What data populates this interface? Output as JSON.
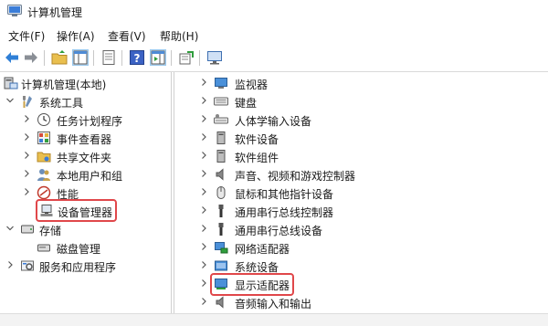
{
  "window": {
    "title": "计算机管理"
  },
  "menu": [
    "文件(F)",
    "操作(A)",
    "查看(V)",
    "帮助(H)"
  ],
  "toolbar": {
    "icons": [
      "back-arrow-icon",
      "forward-arrow-icon",
      "up-folder-icon",
      "show-console-tree-icon",
      "properties-icon",
      "help-icon",
      "action-pane-icon",
      "export-list-icon",
      "monitor-icon"
    ]
  },
  "tree": {
    "root": "计算机管理(本地)",
    "system_tools": "系统工具",
    "task_scheduler": "任务计划程序",
    "event_viewer": "事件查看器",
    "shared_folders": "共享文件夹",
    "local_users": "本地用户和组",
    "performance": "性能",
    "device_manager": "设备管理器",
    "storage": "存储",
    "disk_management": "磁盘管理",
    "services_apps": "服务和应用程序"
  },
  "devices": [
    "监视器",
    "键盘",
    "人体学输入设备",
    "软件设备",
    "软件组件",
    "声音、视频和游戏控制器",
    "鼠标和其他指针设备",
    "通用串行总线控制器",
    "通用串行总线设备",
    "网络适配器",
    "系统设备",
    "显示适配器",
    "音频输入和输出"
  ],
  "highlight_color": "#e0474a"
}
